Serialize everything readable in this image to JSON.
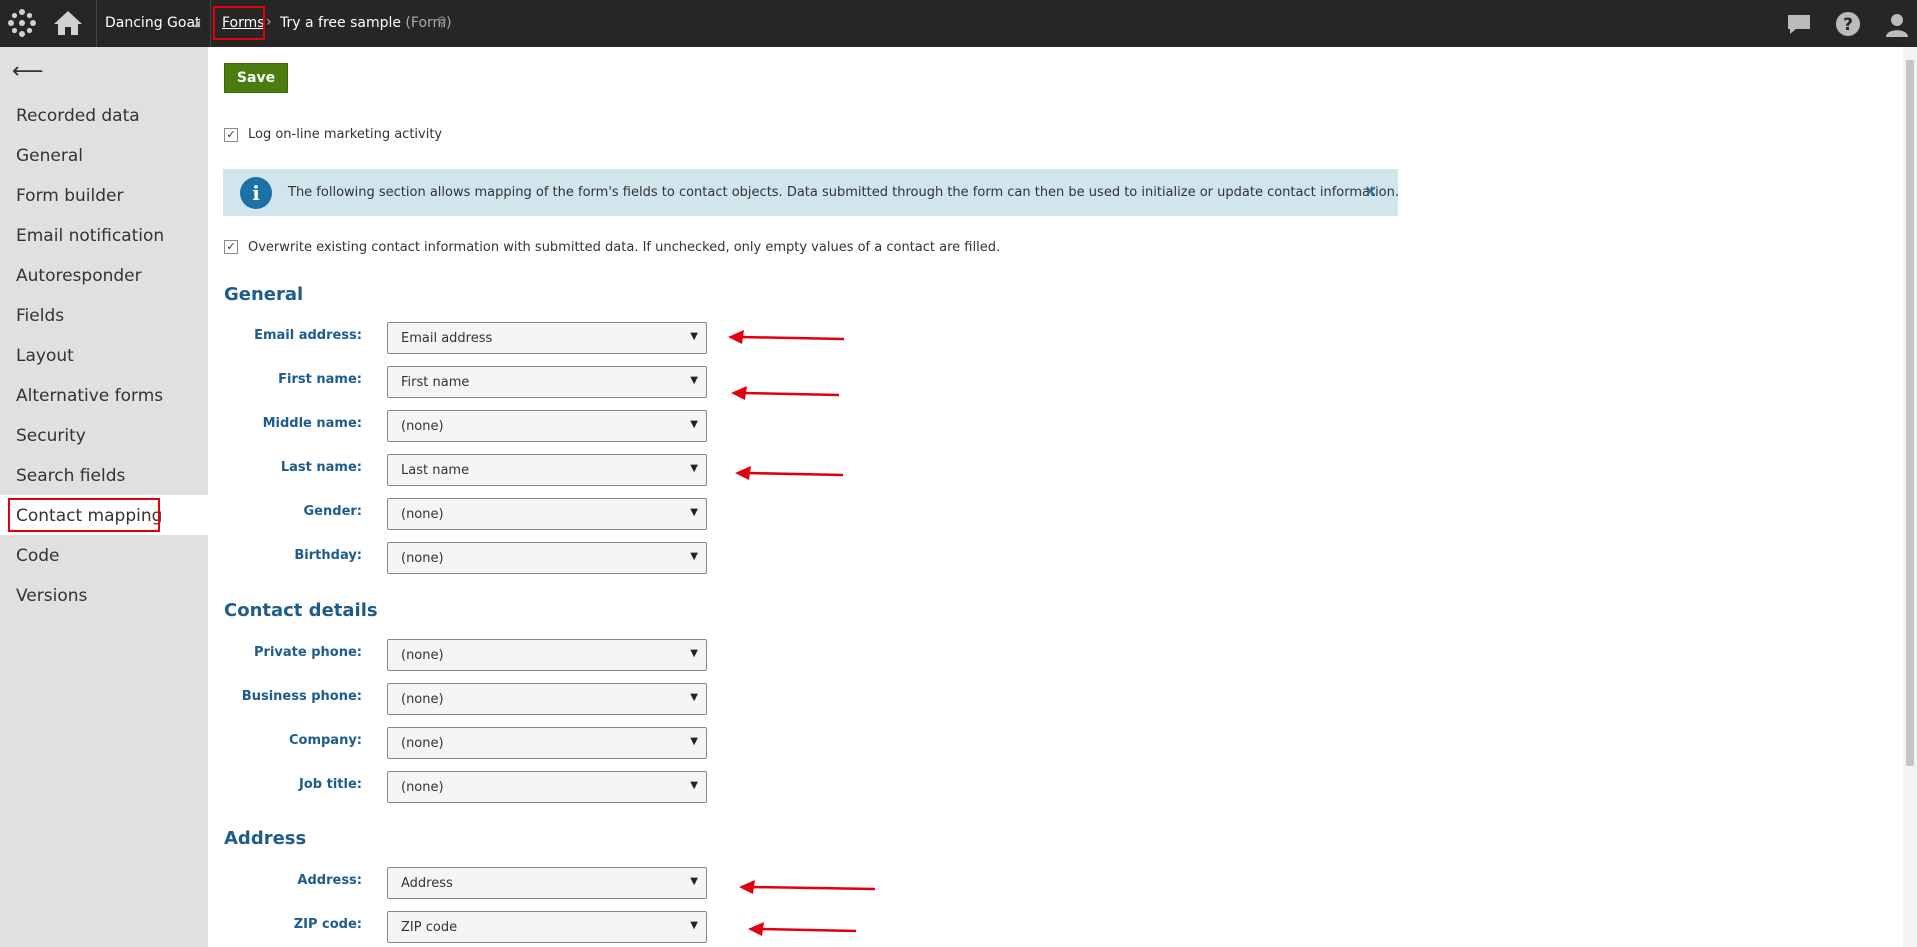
{
  "topbar": {
    "site": "Dancing Goat",
    "breadcrumb_root": "Forms",
    "breadcrumb_current": "Try a free sample",
    "breadcrumb_type": "(Form)",
    "icons": [
      "kentico-logo-icon",
      "home-icon",
      "pin-icon",
      "chat-icon",
      "help-icon",
      "user-icon"
    ]
  },
  "sidebar": {
    "back_icon": "back-arrow-icon",
    "items": [
      {
        "label": "Recorded data"
      },
      {
        "label": "General"
      },
      {
        "label": "Form builder"
      },
      {
        "label": "Email notification"
      },
      {
        "label": "Autoresponder"
      },
      {
        "label": "Fields"
      },
      {
        "label": "Layout"
      },
      {
        "label": "Alternative forms"
      },
      {
        "label": "Security"
      },
      {
        "label": "Search fields"
      },
      {
        "label": "Contact mapping",
        "active": true
      },
      {
        "label": "Code"
      },
      {
        "label": "Versions"
      }
    ]
  },
  "main": {
    "save_label": "Save",
    "log_activity_label": "Log on-line marketing activity",
    "info_text": "The following section allows mapping of the form's fields to contact objects. Data submitted through the form can then be used to initialize or update contact information.",
    "info_close": "✕",
    "overwrite_label": "Overwrite existing contact information with submitted data. If unchecked, only empty values of a contact are filled.",
    "sections": {
      "general": {
        "title": "General",
        "fields": [
          {
            "label": "Email address:",
            "value": "Email address"
          },
          {
            "label": "First name:",
            "value": "First name"
          },
          {
            "label": "Middle name:",
            "value": "(none)"
          },
          {
            "label": "Last name:",
            "value": "Last name"
          },
          {
            "label": "Gender:",
            "value": "(none)"
          },
          {
            "label": "Birthday:",
            "value": "(none)"
          }
        ]
      },
      "contact": {
        "title": "Contact details",
        "fields": [
          {
            "label": "Private phone:",
            "value": "(none)"
          },
          {
            "label": "Business phone:",
            "value": "(none)"
          },
          {
            "label": "Company:",
            "value": "(none)"
          },
          {
            "label": "Job title:",
            "value": "(none)"
          }
        ]
      },
      "address": {
        "title": "Address",
        "fields": [
          {
            "label": "Address:",
            "value": "Address"
          },
          {
            "label": "ZIP code:",
            "value": "ZIP code"
          }
        ]
      }
    }
  },
  "colors": {
    "topbar": "#262626",
    "sidebar": "#e0e0e0",
    "save_button": "#4a7c10",
    "label": "#1d5c8c",
    "info_bg": "#d1e5ec",
    "highlight": "#e2000f"
  }
}
